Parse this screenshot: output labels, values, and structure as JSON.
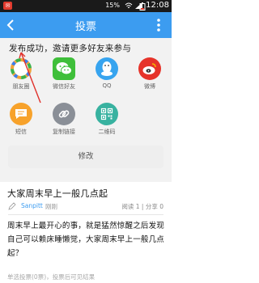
{
  "statusbar": {
    "battery": "15%",
    "time": "12:08"
  },
  "appbar": {
    "title": "投票"
  },
  "share": {
    "message": "发布成功，邀请更多好友来参与",
    "items": [
      {
        "label": "朋友圈",
        "icon": "wechat-moments-icon"
      },
      {
        "label": "微信好友",
        "icon": "wechat-icon"
      },
      {
        "label": "QQ",
        "icon": "qq-icon"
      },
      {
        "label": "微博",
        "icon": "weibo-icon"
      },
      {
        "label": "短信",
        "icon": "sms-icon"
      },
      {
        "label": "复制链接",
        "icon": "link-icon"
      },
      {
        "label": "二维码",
        "icon": "qrcode-icon"
      }
    ]
  },
  "modify_label": "修改",
  "post": {
    "title": "大家周末早上一般几点起",
    "author": "Sanpitt",
    "time": "刚刚",
    "meta": "阅读 1 | 分享 0",
    "body": "周末早上最开心的事，就是猛然惊醒之后发现自己可以赖床睡懒觉，大家周末早上一般几点起？",
    "footer_note": "单选投票(0票)，投票后可见结果"
  },
  "colors": {
    "accent": "#3c9cf0",
    "annotation": "#e0302a"
  }
}
